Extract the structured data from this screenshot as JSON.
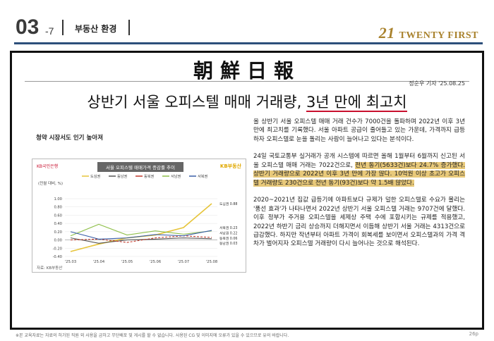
{
  "header": {
    "section_number": "03",
    "section_sub": "-7",
    "section_title": "부동산 환경",
    "logo_mark": "21",
    "logo_text": "TWENTY FIRST"
  },
  "paper": {
    "name": "朝鮮日報",
    "byline": "정순우 기자  '25.08.25",
    "headline_pre": "상반기 서울 오피스텔 매매 거래량, ",
    "headline_hl": "3년 만에 최고치",
    "subhead": "청약 시장서도 인기 높아져"
  },
  "chart_data": {
    "type": "line",
    "title": "서울 오피스텔 매매가격 증감률 추이",
    "source_left": "KB국민은행",
    "source_right": "KB부동산",
    "ylabel": "(전월 대비, %)",
    "footnote": "자료: KB부동산",
    "categories": [
      "'25.03",
      "'25.04",
      "'25.05",
      "'25.06",
      "'25.07",
      "'25.08"
    ],
    "ylim": [
      -0.4,
      1.0
    ],
    "yticks": [
      "1.00",
      "0.80",
      "0.60",
      "0.40",
      "0.20",
      "0.00",
      "-0.20",
      "-0.40"
    ],
    "series": [
      {
        "name": "도심권",
        "color": "#e6c43a",
        "values": [
          -0.28,
          -0.1,
          0.05,
          0.12,
          0.3,
          0.88
        ],
        "end_label": "도심권 0.88"
      },
      {
        "name": "동남권",
        "color": "#555555",
        "values": [
          0.05,
          -0.08,
          0.0,
          0.02,
          0.05,
          0.03
        ],
        "end_label": "동남권 0.03"
      },
      {
        "name": "동북권",
        "color": "#c0392b",
        "values": [
          0.0,
          0.02,
          -0.06,
          0.05,
          0.1,
          0.06
        ],
        "end_label": "동북권 0.06"
      },
      {
        "name": "서남권",
        "color": "#8fbf4a",
        "values": [
          0.1,
          0.38,
          0.12,
          0.22,
          0.14,
          0.22
        ],
        "end_label": "서남권 0.22"
      },
      {
        "name": "서북권",
        "color": "#3b5fa8",
        "values": [
          0.2,
          0.02,
          0.05,
          0.13,
          0.1,
          0.23
        ],
        "end_label": "서북권 0.23"
      }
    ]
  },
  "article": {
    "p1": "올 상반기 서울 오피스텔 매매 거래 건수가 7000건을 돌파하며 2022년 이후 3년 만에 최고치를 기록했다. 서울 아파트 공급이 줄어들고 있는 가운데, 가격까지 급등하자 오피스텔로 눈을 돌리는 사람이 늘어나고 있다는 분석이다.",
    "p2_pre": "24일 국토교통부 실거래가 공개 시스템에 따르면 올해 1월부터 6월까지 신고된 서울 오피스텔 매매 거래는 7022건으로, ",
    "p2_hl": "전년 동기(5633건)보다 24.7% 증가했다. 상반기 거래량으로 2022년 이후 3년 만에 가장 많다. 10억원 이상 초고가 오피스텔 거래량도 230건으로 전년 동기(93건)보다 약 1.5배 많았다.",
    "p3": "2020~2021년 집값 급등기에 아파트보다 규제가 덜한 오피스텔로 수요가 몰리는 '풍선 효과'가 나타나면서 2022년 상반기 서울 오피스텔 거래는 9707건에 달했다. 이후 정부가 주거용 오피스텔을 세제상 주택 수에 포함시키는 규제를 적용했고, 2022년 하반기 금리 상승까지 더해지면서 이듬해 상반기 서울 거래는 4313건으로 급감했다. 하지만 작년부터 아파트 가격이 회복세를 보이면서 오피스텔과의 가격 격차가 벌어지자 오피스텔 거래량이 다시 늘어나는 것으로 해석된다."
  },
  "footer": {
    "disclaimer": "※본 교육자료는 자료의 허가된 직원 외 사용을 금하고 무단배포 및 게시를 할 수 없습니다. 사용된 CG 및 이미지에 오류가 있을 수 있으므로 유의 바랍니다.",
    "page": "26p"
  }
}
